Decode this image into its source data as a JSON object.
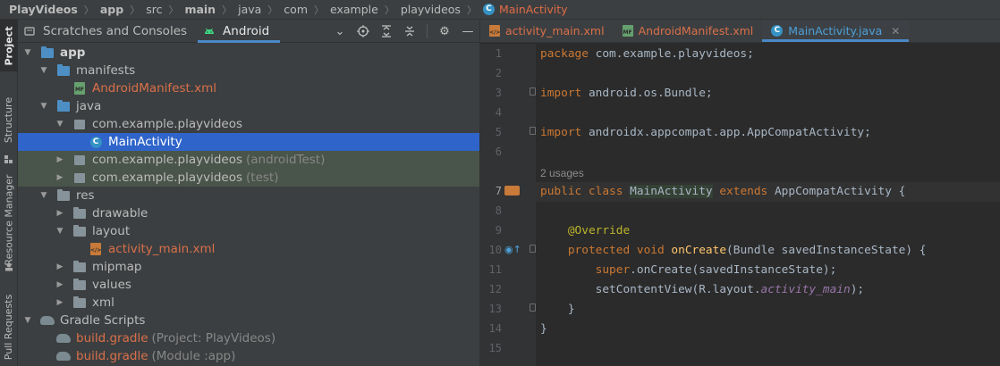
{
  "breadcrumb": {
    "items": [
      "PlayVideos",
      "app",
      "src",
      "main",
      "java",
      "com",
      "example",
      "playvideos"
    ],
    "current": "MainActivity"
  },
  "tool_strip": {
    "project": "Project",
    "structure": "Structure",
    "resource_manager": "Resource Manager",
    "pull_requests": "Pull Requests"
  },
  "project_panel": {
    "tabs": [
      "Scratches and Consoles",
      "Android"
    ],
    "tree": [
      {
        "label": "app",
        "extra": ""
      },
      {
        "label": "manifests",
        "extra": ""
      },
      {
        "label": "AndroidManifest.xml",
        "extra": ""
      },
      {
        "label": "java",
        "extra": ""
      },
      {
        "label": "com.example.playvideos",
        "extra": ""
      },
      {
        "label": "MainActivity",
        "extra": ""
      },
      {
        "label": "com.example.playvideos",
        "extra": "(androidTest)"
      },
      {
        "label": "com.example.playvideos",
        "extra": "(test)"
      },
      {
        "label": "res",
        "extra": ""
      },
      {
        "label": "drawable",
        "extra": ""
      },
      {
        "label": "layout",
        "extra": ""
      },
      {
        "label": "activity_main.xml",
        "extra": ""
      },
      {
        "label": "mipmap",
        "extra": ""
      },
      {
        "label": "values",
        "extra": ""
      },
      {
        "label": "xml",
        "extra": ""
      },
      {
        "label": "Gradle Scripts",
        "extra": ""
      },
      {
        "label": "build.gradle",
        "extra": "(Project: PlayVideos)"
      },
      {
        "label": "build.gradle",
        "extra": "(Module :app)"
      }
    ]
  },
  "editor": {
    "tabs": [
      "activity_main.xml",
      "AndroidManifest.xml",
      "MainActivity.java"
    ],
    "active_tab": "MainActivity.java",
    "line_numbers": [
      "1",
      "2",
      "3",
      "4",
      "5",
      "6",
      "7",
      "8",
      "9",
      "10",
      "11",
      "12",
      "13",
      "14",
      "15"
    ],
    "usages_hint": "2 usages",
    "code": {
      "l1_kw": "package",
      "l1_rest": " com.example.playvideos;",
      "l3_kw": "import",
      "l3_rest": " android.os.Bundle;",
      "l5_kw": "import",
      "l5_rest": " androidx.appcompat.app.AppCompatActivity;",
      "l7_kw1": "public class ",
      "l7_cls": "MainActivity",
      "l7_kw2": " extends ",
      "l7_rest": "AppCompatActivity {",
      "l9_ann": "@Override",
      "l10_kw": "protected void ",
      "l10_fn": "onCreate",
      "l10_rest": "(Bundle savedInstanceState) {",
      "l11_kw": "super",
      "l11_rest": ".onCreate(savedInstanceState);",
      "l12_pre": "setContentView(R.layout.",
      "l12_ital": "activity_main",
      "l12_post": ");",
      "l13": "}",
      "l14": "}"
    }
  },
  "colors": {
    "accent": "#4a88c7",
    "selection": "#2f65ca",
    "keyword": "#cc7832",
    "annotation": "#bbb529",
    "function": "#ffc66d"
  }
}
